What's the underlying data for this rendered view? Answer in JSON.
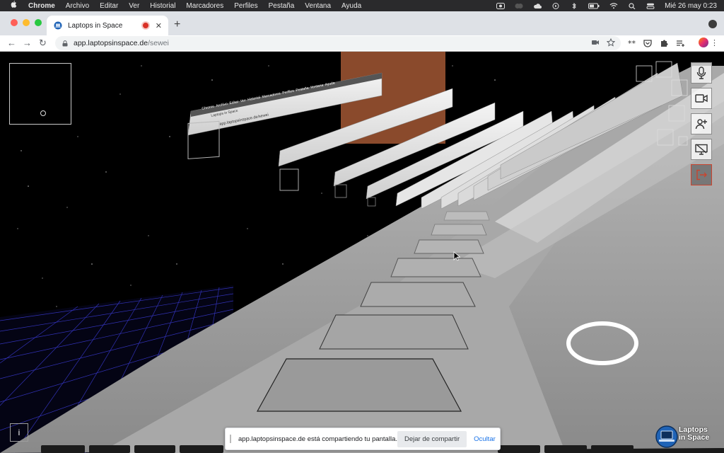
{
  "menubar": {
    "app_name": "Chrome",
    "items": [
      "Archivo",
      "Editar",
      "Ver",
      "Historial",
      "Marcadores",
      "Perfiles",
      "Pestaña",
      "Ventana",
      "Ayuda"
    ],
    "clock": "Mié 26 may  0:23"
  },
  "tab": {
    "title": "Laptops in Space",
    "recording": true
  },
  "address": {
    "host": "app.laptopsinspace.de",
    "path": "/sewei"
  },
  "share_bar": {
    "message": "app.laptopsinspace.de está compartiendo tu pantalla.",
    "stop_label": "Dejar de compartir",
    "hide_label": "Ocultar"
  },
  "info_button": {
    "label": "i"
  },
  "brand": {
    "line1": "Laptops",
    "line2": "in Space"
  },
  "side_controls": [
    {
      "name": "microphone",
      "icon": "microphone-icon"
    },
    {
      "name": "camera",
      "icon": "video-camera-icon"
    },
    {
      "name": "add-user",
      "icon": "add-user-icon"
    },
    {
      "name": "screen-share",
      "icon": "screen-share-off-icon"
    },
    {
      "name": "leave",
      "icon": "exit-icon"
    }
  ],
  "colors": {
    "record_red": "#d93025",
    "exit_red": "#c9442f",
    "link_blue": "#1a73e8",
    "grid_blue": "#3b3bd6"
  },
  "recursive_window": {
    "menu_items": [
      "Chrome",
      "Archivo",
      "Editar",
      "Ver",
      "Historial",
      "Marcadores",
      "Perfiles",
      "Pestaña",
      "Ventana",
      "Ayuda"
    ],
    "tab_title": "Laptops in Space",
    "address": "app.laptopsinspace.de/sewei"
  }
}
